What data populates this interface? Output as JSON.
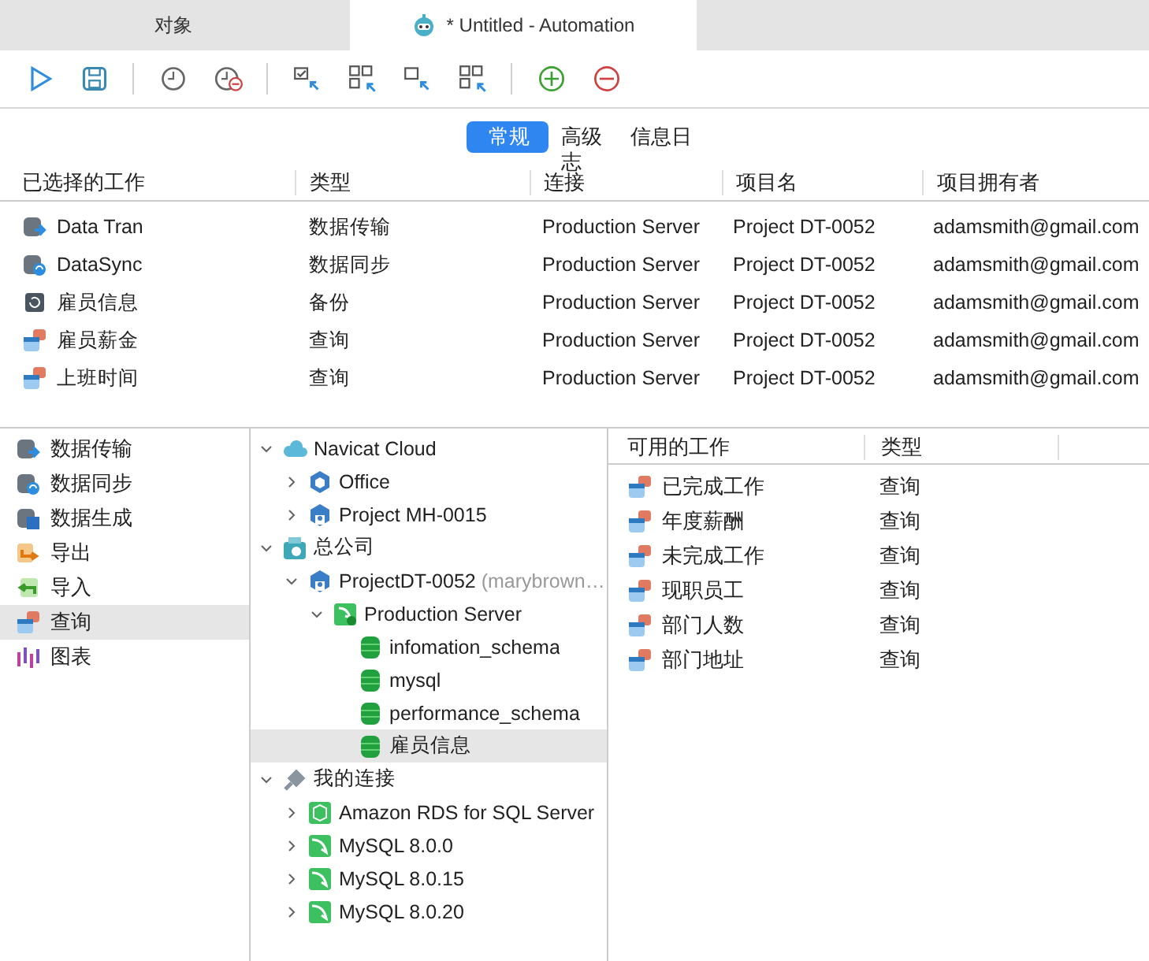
{
  "tabs": [
    {
      "label": "对象",
      "selected": false,
      "kind": "plain"
    },
    {
      "label": "* Untitled - Automation",
      "selected": true,
      "kind": "robot"
    }
  ],
  "subtabs": [
    {
      "label": "常规",
      "selected": true
    },
    {
      "label": "高级志",
      "selected": false
    },
    {
      "label": "信息日",
      "selected": false
    }
  ],
  "jobs_table": {
    "columns": [
      "已选择的工作",
      "类型",
      "连接",
      "项目名",
      "项目拥有者"
    ],
    "rows": [
      {
        "kind": "transfer",
        "cells": [
          "Data Tran",
          "数据传输",
          "Production Server",
          "Project DT-0052",
          "adamsmith@gmail.com"
        ]
      },
      {
        "kind": "sync",
        "cells": [
          "DataSync",
          "数据同步",
          "Production Server",
          "Project DT-0052",
          "adamsmith@gmail.com"
        ]
      },
      {
        "kind": "backup",
        "cells": [
          "雇员信息",
          "备份",
          "Production Server",
          "Project DT-0052",
          "adamsmith@gmail.com"
        ]
      },
      {
        "kind": "query",
        "cells": [
          "雇员薪金",
          "查询",
          "Production Server",
          "Project DT-0052",
          "adamsmith@gmail.com"
        ]
      },
      {
        "kind": "query",
        "cells": [
          "上班时间",
          "查询",
          "Production Server",
          "Project DT-0052",
          "adamsmith@gmail.com"
        ]
      }
    ]
  },
  "sidebar": {
    "items": [
      {
        "label": "数据传输",
        "kind": "transfer",
        "selected": false
      },
      {
        "label": "数据同步",
        "kind": "sync",
        "selected": false
      },
      {
        "label": "数据生成",
        "kind": "generate",
        "selected": false
      },
      {
        "label": "导出",
        "kind": "export",
        "selected": false
      },
      {
        "label": "导入",
        "kind": "import",
        "selected": false
      },
      {
        "label": "查询",
        "kind": "query",
        "selected": true
      },
      {
        "label": "图表",
        "kind": "chart",
        "selected": false
      }
    ]
  },
  "tree": [
    {
      "label": "Navicat Cloud",
      "kind": "cloud",
      "expanded": true,
      "selected": false,
      "children": [
        {
          "label": "Office",
          "kind": "hexagon",
          "expanded": false,
          "selected": false
        },
        {
          "label": "Project MH-0015",
          "kind": "project",
          "expanded": false,
          "selected": false
        }
      ]
    },
    {
      "label": "总公司",
      "kind": "company",
      "expanded": true,
      "selected": false,
      "children": [
        {
          "label": "ProjectDT-0052",
          "note": "(marybrown…",
          "kind": "project",
          "expanded": true,
          "selected": false,
          "children": [
            {
              "label": "Production Server",
              "kind": "server",
              "expanded": true,
              "selected": false,
              "children": [
                {
                  "label": "infomation_schema",
                  "kind": "database",
                  "selected": false
                },
                {
                  "label": "mysql",
                  "kind": "database",
                  "selected": false
                },
                {
                  "label": "performance_schema",
                  "kind": "database",
                  "selected": false
                },
                {
                  "label": "雇员信息",
                  "kind": "database",
                  "selected": true
                }
              ]
            }
          ]
        }
      ]
    },
    {
      "label": "我的连接",
      "kind": "plug",
      "expanded": true,
      "selected": false,
      "children": [
        {
          "label": "Amazon RDS for SQL Server",
          "kind": "rds",
          "expanded": false,
          "selected": false
        },
        {
          "label": "MySQL 8.0.0",
          "kind": "mysql",
          "expanded": false,
          "selected": false
        },
        {
          "label": "MySQL 8.0.15",
          "kind": "mysql",
          "expanded": false,
          "selected": false
        },
        {
          "label": "MySQL 8.0.20",
          "kind": "mysql",
          "expanded": false,
          "selected": false
        }
      ]
    }
  ],
  "available": {
    "columns": [
      "可用的工作",
      "类型"
    ],
    "rows": [
      {
        "kind": "query",
        "cells": [
          "已完成工作",
          "查询"
        ]
      },
      {
        "kind": "query",
        "cells": [
          "年度薪酬",
          "查询"
        ]
      },
      {
        "kind": "query",
        "cells": [
          "未完成工作",
          "查询"
        ]
      },
      {
        "kind": "query",
        "cells": [
          "现职员工",
          "查询"
        ]
      },
      {
        "kind": "query",
        "cells": [
          "部门人数",
          "查询"
        ]
      },
      {
        "kind": "query",
        "cells": [
          "部门地址",
          "查询"
        ]
      }
    ]
  }
}
